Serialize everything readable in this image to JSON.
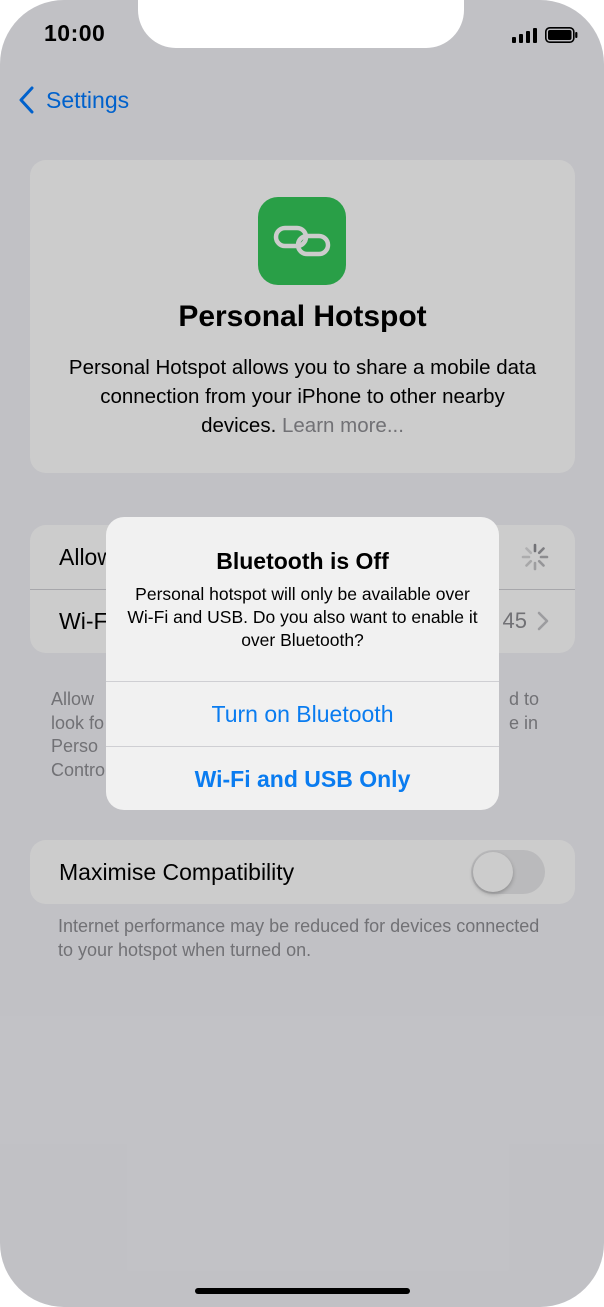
{
  "status_bar": {
    "time": "10:00"
  },
  "nav": {
    "back_label": "Settings"
  },
  "hero": {
    "title": "Personal Hotspot",
    "description": "Personal Hotspot allows you to share a mobile data connection from your iPhone to other nearby devices.",
    "learn_more": "Learn more..."
  },
  "rows": {
    "allow_label": "Allow",
    "wifi_label": "Wi-F",
    "wifi_value": "45"
  },
  "footnote": {
    "left": "Allow\nlook fo\nPerso\nContro",
    "right": "d to\ne in"
  },
  "compatibility": {
    "label": "Maximise Compatibility",
    "enabled": false,
    "note": "Internet performance may be reduced for devices connected to your hotspot when turned on."
  },
  "alert": {
    "title": "Bluetooth is Off",
    "message": "Personal hotspot will only be available over Wi-Fi and USB. Do you also want to enable it over Bluetooth?",
    "button_primary": "Turn on Bluetooth",
    "button_secondary": "Wi-Fi and USB Only"
  },
  "colors": {
    "accent": "#007aff",
    "hotspot_green": "#34c759",
    "alert_button": "#0a7cf0"
  }
}
